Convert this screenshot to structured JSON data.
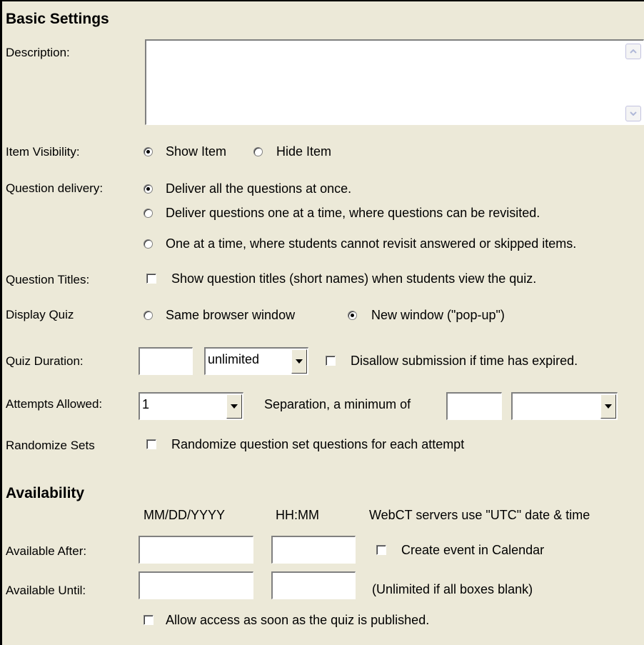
{
  "basic": {
    "title": "Basic Settings",
    "description_label": "Description:",
    "description_value": "",
    "visibility": {
      "label": "Item Visibility:",
      "show": "Show Item",
      "hide": "Hide Item",
      "selected": "show"
    },
    "delivery": {
      "label": "Question delivery:",
      "options": [
        "Deliver all the questions at once.",
        "Deliver questions one at a time, where questions can be revisited.",
        "One at a time, where students cannot revisit answered or skipped items."
      ],
      "selected": 0
    },
    "titles": {
      "label": "Question Titles:",
      "checkbox": "Show question titles (short names) when students view the quiz.",
      "checked": false
    },
    "display": {
      "label": "Display Quiz",
      "same": "Same browser window",
      "new": "New window (\"pop-up\")",
      "selected": "new"
    },
    "duration": {
      "label": "Quiz Duration:",
      "value": "",
      "unit": "unlimited",
      "disallow": "Disallow submission if time has expired.",
      "checked": false
    },
    "attempts": {
      "label": "Attempts Allowed:",
      "value": "1",
      "separation": "Separation, a minimum of",
      "sep_value": "",
      "sep_unit": ""
    },
    "randomize": {
      "label": "Randomize Sets",
      "checkbox": "Randomize question set questions for each attempt",
      "checked": false
    }
  },
  "availability": {
    "title": "Availability",
    "date_header": "MM/DD/YYYY",
    "time_header": "HH:MM",
    "utc_note": "WebCT servers use \"UTC\" date & time",
    "after_label": "Available After:",
    "after_date": "",
    "after_time": "",
    "calendar": "Create event in Calendar",
    "until_label": "Available Until:",
    "until_date": "",
    "until_time": "",
    "unlimited_note": "(Unlimited if all boxes blank)",
    "allow_access": "Allow access as soon as the quiz is published."
  }
}
